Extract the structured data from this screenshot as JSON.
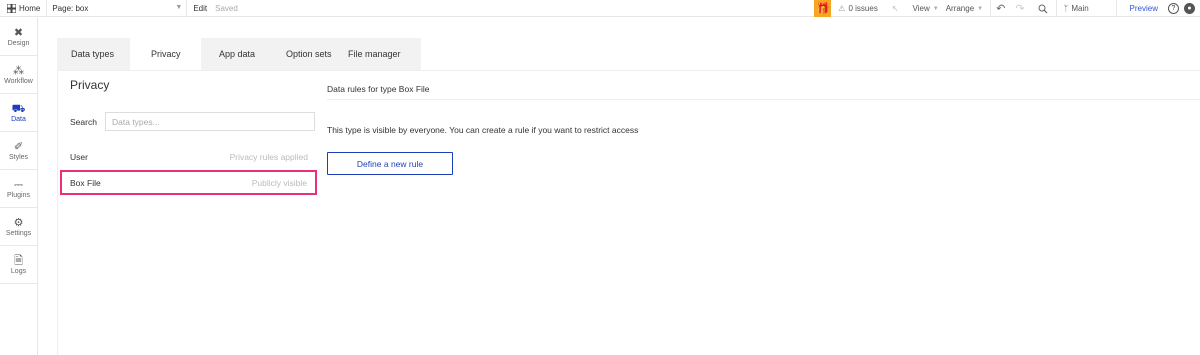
{
  "topbar": {
    "home_label": "Home",
    "page_label": "Page: box",
    "edit_label": "Edit",
    "saved_label": "Saved",
    "issues_label": "0 issues",
    "view_label": "View",
    "arrange_label": "Arrange",
    "branch_label": "Main",
    "preview_label": "Preview",
    "help_glyph": "?",
    "accent_color": "#f5a623"
  },
  "leftnav": {
    "items": [
      {
        "label": "Design",
        "icon": "design-tools-icon"
      },
      {
        "label": "Workflow",
        "icon": "workflow-icon"
      },
      {
        "label": "Data",
        "icon": "database-icon",
        "active": true
      },
      {
        "label": "Styles",
        "icon": "brush-icon"
      },
      {
        "label": "Plugins",
        "icon": "plug-icon"
      },
      {
        "label": "Settings",
        "icon": "gear-icon"
      },
      {
        "label": "Logs",
        "icon": "document-icon"
      }
    ],
    "active_color": "#1e3fb8"
  },
  "tabs": [
    {
      "label": "Data types"
    },
    {
      "label": "Privacy",
      "active": true
    },
    {
      "label": "App data"
    },
    {
      "label": "Option sets"
    },
    {
      "label": "File manager"
    }
  ],
  "privacy": {
    "title": "Privacy",
    "search_label": "Search",
    "search_placeholder": "Data types...",
    "types": [
      {
        "name": "User",
        "status": "Privacy rules applied"
      },
      {
        "name": "Box File",
        "status": "Publicly visible",
        "selected": true
      }
    ],
    "highlight_color": "#e8317a"
  },
  "rules": {
    "header": "Data rules for type Box File",
    "info": "This type is visible by everyone. You can create a rule if you want to restrict access",
    "new_rule_button": "Define a new rule",
    "button_color": "#1e3fb8"
  }
}
